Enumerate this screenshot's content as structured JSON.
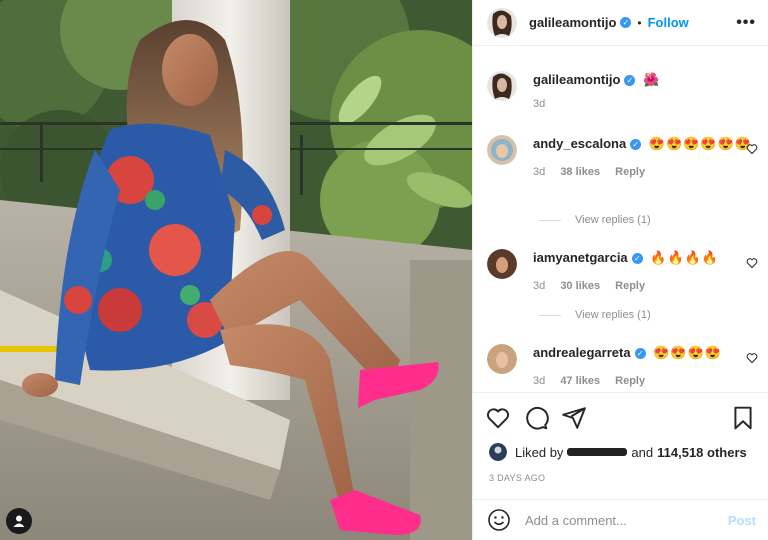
{
  "header": {
    "username": "galileamontijo",
    "follow_label": "Follow",
    "separator": "•",
    "more_label": "•••"
  },
  "caption": {
    "username": "galileamontijo",
    "text": "🌺",
    "age": "3d"
  },
  "comments": [
    {
      "username": "andy_escalona",
      "text": "😍😍😍😍😍😍",
      "age": "3d",
      "likes": "38 likes",
      "reply_label": "Reply",
      "view_replies": "View replies (1)"
    },
    {
      "username": "iamyanetgarcia",
      "text": "🔥🔥🔥🔥",
      "age": "3d",
      "likes": "30 likes",
      "reply_label": "Reply",
      "view_replies": "View replies (1)"
    },
    {
      "username": "andrealegarreta",
      "text": "😍😍😍😍",
      "age": "3d",
      "likes": "47 likes",
      "reply_label": "Reply"
    }
  ],
  "likes": {
    "prefix": "Liked by",
    "connector": "and",
    "count": "114,518 others"
  },
  "post_date": "3 DAYS AGO",
  "add_comment": {
    "placeholder": "Add a comment...",
    "post_label": "Post"
  },
  "colors": {
    "accent": "#0095f6",
    "verified": "#3897f0",
    "muted": "#8e8e8e",
    "post_disabled": "#b2dffc"
  },
  "icons": [
    "verified-badge-icon",
    "heart-icon",
    "comment-icon",
    "share-icon",
    "bookmark-icon",
    "smile-icon",
    "user-tag-icon",
    "more-icon"
  ]
}
